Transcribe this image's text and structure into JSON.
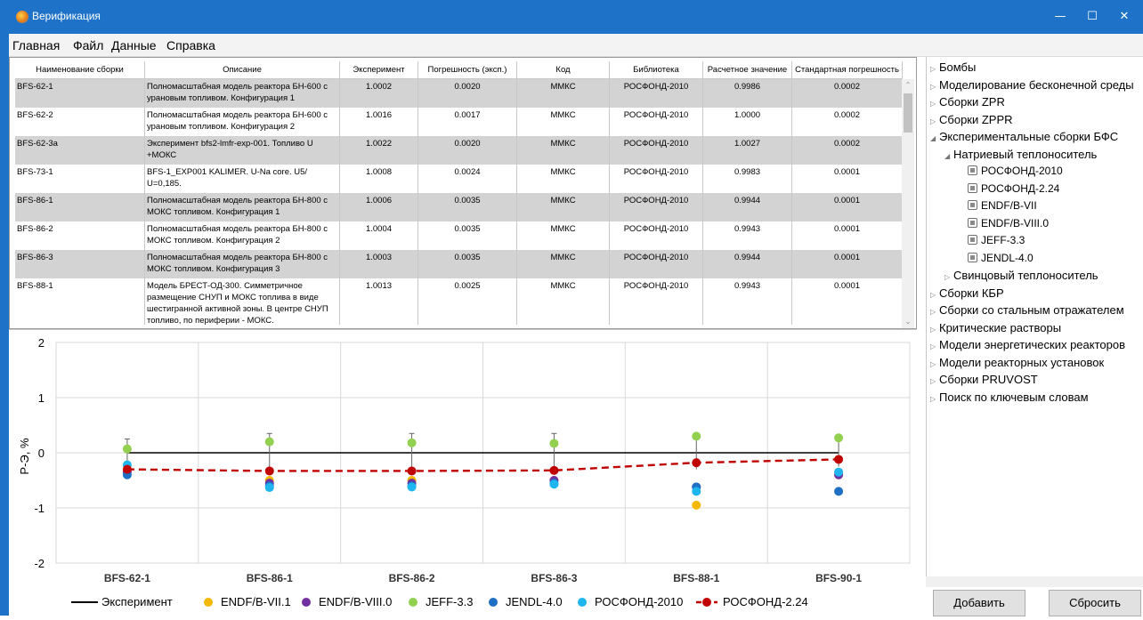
{
  "window": {
    "title": "Верификация",
    "controls": {
      "minimize": "—",
      "maximize": "☐",
      "close": "✕"
    }
  },
  "menu": [
    "Главная",
    "Файл",
    "Данные",
    "Справка"
  ],
  "table": {
    "columns": [
      "Наименование сборки",
      "Описание",
      "Эксперимент",
      "Погрешность (эксп.)",
      "Код",
      "Библиотека",
      "Расчетное значение",
      "Стандартная погрешность"
    ],
    "rows": [
      {
        "name": "BFS-62-1",
        "desc": "Полномасштабная модель реактора БН-600 с урановым топливом. Конфигурация 1",
        "exp": "1.0002",
        "err": "0.0020",
        "code": "ММКС",
        "lib": "РОСФОНД-2010",
        "calc": "0.9986",
        "std": "0.0002"
      },
      {
        "name": "BFS-62-2",
        "desc": "Полномасштабная модель реактора БН-600 с урановым топливом. Конфигурация 2",
        "exp": "1.0016",
        "err": "0.0017",
        "code": "ММКС",
        "lib": "РОСФОНД-2010",
        "calc": "1.0000",
        "std": "0.0002"
      },
      {
        "name": "BFS-62-3a",
        "desc": "Эксперимент bfs2-lmfr-exp-001. Топливо U +МОКС",
        "exp": "1.0022",
        "err": "0.0020",
        "code": "ММКС",
        "lib": "РОСФОНД-2010",
        "calc": "1.0027",
        "std": "0.0002"
      },
      {
        "name": "BFS-73-1",
        "desc": "BFS-1_EXP001 KALIMER. U-Na core. U5/ U=0,185.",
        "exp": "1.0008",
        "err": "0.0024",
        "code": "ММКС",
        "lib": "РОСФОНД-2010",
        "calc": "0.9983",
        "std": "0.0001"
      },
      {
        "name": "BFS-86-1",
        "desc": "Полномасштабная модель реактора БН-800 с МОКС топливом. Конфигурация 1",
        "exp": "1.0006",
        "err": "0.0035",
        "code": "ММКС",
        "lib": "РОСФОНД-2010",
        "calc": "0.9944",
        "std": "0.0001"
      },
      {
        "name": "BFS-86-2",
        "desc": "Полномасштабная модель реактора БН-800 с МОКС топливом. Конфигурация 2",
        "exp": "1.0004",
        "err": "0.0035",
        "code": "ММКС",
        "lib": "РОСФОНД-2010",
        "calc": "0.9943",
        "std": "0.0001"
      },
      {
        "name": "BFS-86-3",
        "desc": "Полномасштабная модель реактора БН-800 с МОКС топливом. Конфигурация 3",
        "exp": "1.0003",
        "err": "0.0035",
        "code": "ММКС",
        "lib": "РОСФОНД-2010",
        "calc": "0.9944",
        "std": "0.0001"
      },
      {
        "name": "BFS-88-1",
        "desc": "Модель БРЕСТ-ОД-300. Симметричное размещение СНУП и МОКС топлива в виде шестигранной активной зоны. В центре СНУП топливо, по периферии - МОКС.",
        "exp": "1.0013",
        "err": "0.0025",
        "code": "ММКС",
        "lib": "РОСФОНД-2010",
        "calc": "0.9943",
        "std": "0.0001"
      }
    ]
  },
  "tree": {
    "items": [
      {
        "label": "Бомбы",
        "level": 0,
        "expanded": false
      },
      {
        "label": "Моделирование бесконечной среды",
        "level": 0,
        "expanded": false
      },
      {
        "label": "Сборки ZPR",
        "level": 0,
        "expanded": false
      },
      {
        "label": "Сборки ZPPR",
        "level": 0,
        "expanded": false
      },
      {
        "label": "Экспериментальные сборки БФС",
        "level": 0,
        "expanded": true
      },
      {
        "label": "Натриевый теплоноситель",
        "level": 1,
        "expanded": true
      },
      {
        "label": "РОСФОНД-2010",
        "level": 2,
        "leaf": true
      },
      {
        "label": "РОСФОНД-2.24",
        "level": 2,
        "leaf": true
      },
      {
        "label": "ENDF/B-VII",
        "level": 2,
        "leaf": true
      },
      {
        "label": "ENDF/B-VIII.0",
        "level": 2,
        "leaf": true
      },
      {
        "label": "JEFF-3.3",
        "level": 2,
        "leaf": true
      },
      {
        "label": "JENDL-4.0",
        "level": 2,
        "leaf": true
      },
      {
        "label": "Свинцовый теплоноситель",
        "level": 1,
        "expanded": false
      },
      {
        "label": "Сборки КБР",
        "level": 0,
        "expanded": false
      },
      {
        "label": "Сборки со стальным отражателем",
        "level": 0,
        "expanded": false
      },
      {
        "label": "Критические растворы",
        "level": 0,
        "expanded": false
      },
      {
        "label": "Модели энергетических реакторов",
        "level": 0,
        "expanded": false
      },
      {
        "label": "Модели реакторных установок",
        "level": 0,
        "expanded": false
      },
      {
        "label": "Сборки PRUVOST",
        "level": 0,
        "expanded": false
      },
      {
        "label": "Поиск по ключевым словам",
        "level": 0,
        "expanded": false
      }
    ]
  },
  "buttons": {
    "add": "Добавить",
    "reset": "Сбросить"
  },
  "colors": {
    "accent": "#1e73c8",
    "endf71": "#f5b800",
    "endf80": "#7030a0",
    "jeff": "#92d050",
    "jendl": "#1f6fc4",
    "rosfond2010": "#1fb5ee",
    "rosfond224": "#c00000"
  },
  "chart_data": {
    "type": "scatter",
    "categories": [
      "BFS-62-1",
      "BFS-86-1",
      "BFS-86-2",
      "BFS-86-3",
      "BFS-88-1",
      "BFS-90-1"
    ],
    "ylabel": "Р-Э, %",
    "ylim": [
      -2,
      2
    ],
    "yticks": [
      "2",
      "1",
      "0",
      "-1",
      "-2"
    ],
    "grid": true,
    "legend_position": "bottom",
    "experiment": {
      "name": "Эксперимент",
      "values": [
        0,
        0,
        0,
        0,
        0,
        0
      ],
      "errors": [
        0.25,
        0.35,
        0.35,
        0.35,
        0.3,
        0.25
      ]
    },
    "series": [
      {
        "name": "ENDF/B-VII.1",
        "color": "#f5b800",
        "values": [
          -0.3,
          -0.5,
          -0.5,
          -0.5,
          -0.95,
          -0.4
        ]
      },
      {
        "name": "ENDF/B-VIII.0",
        "color": "#7030a0",
        "values": [
          -0.35,
          -0.55,
          -0.55,
          -0.5,
          -0.62,
          -0.4
        ]
      },
      {
        "name": "JEFF-3.3",
        "color": "#92d050",
        "values": [
          0.07,
          0.2,
          0.18,
          0.17,
          0.3,
          0.27
        ]
      },
      {
        "name": "JENDL-4.0",
        "color": "#1f6fc4",
        "values": [
          -0.4,
          -0.6,
          -0.6,
          -0.55,
          -0.62,
          -0.7
        ]
      },
      {
        "name": "РОСФОНД-2010",
        "color": "#1fb5ee",
        "values": [
          -0.22,
          -0.63,
          -0.62,
          -0.57,
          -0.7,
          -0.35
        ]
      },
      {
        "name": "РОСФОНД-2.24",
        "color": "#c00000",
        "values": [
          -0.3,
          -0.33,
          -0.33,
          -0.32,
          -0.18,
          -0.12
        ],
        "line": "dashed"
      }
    ]
  }
}
